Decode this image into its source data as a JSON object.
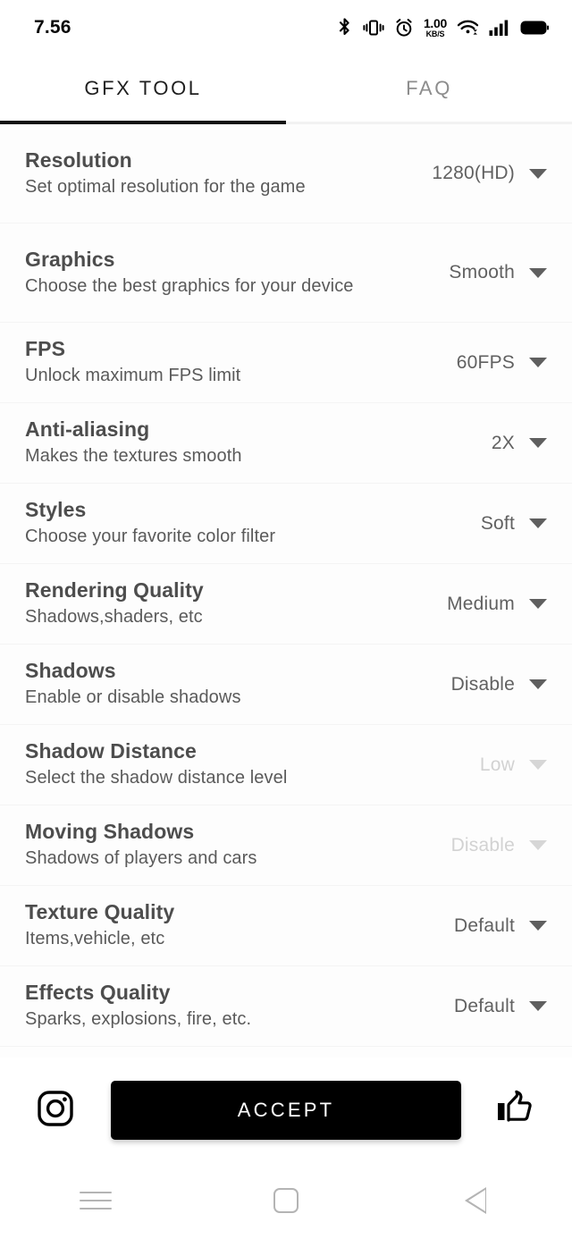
{
  "status_bar": {
    "time": "7.56",
    "data_rate_value": "1.00",
    "data_rate_unit": "KB/S",
    "icons": [
      "bluetooth-icon",
      "vibrate-icon",
      "alarm-icon",
      "data-rate-indicator",
      "wifi-icon",
      "cellular-signal-icon",
      "battery-icon"
    ]
  },
  "tabs": [
    {
      "label": "GFX TOOL",
      "active": true
    },
    {
      "label": "FAQ",
      "active": false
    }
  ],
  "settings": [
    {
      "title": "Resolution",
      "subtitle": "Set optimal resolution for the game",
      "value": "1280(HD)",
      "disabled": false
    },
    {
      "title": "Graphics",
      "subtitle": "Choose the best graphics for your device",
      "value": "Smooth",
      "disabled": false
    },
    {
      "title": "FPS",
      "subtitle": "Unlock maximum FPS limit",
      "value": "60FPS",
      "disabled": false
    },
    {
      "title": "Anti-aliasing",
      "subtitle": "Makes the textures smooth",
      "value": "2X",
      "disabled": false
    },
    {
      "title": "Styles",
      "subtitle": "Choose your favorite color filter",
      "value": "Soft",
      "disabled": false
    },
    {
      "title": "Rendering Quality",
      "subtitle": "Shadows,shaders, etc",
      "value": "Medium",
      "disabled": false
    },
    {
      "title": "Shadows",
      "subtitle": "Enable or disable shadows",
      "value": "Disable",
      "disabled": false
    },
    {
      "title": "Shadow Distance",
      "subtitle": "Select the shadow distance level",
      "value": "Low",
      "disabled": true
    },
    {
      "title": "Moving Shadows",
      "subtitle": "Shadows of players and cars",
      "value": "Disable",
      "disabled": true
    },
    {
      "title": "Texture Quality",
      "subtitle": "Items,vehicle, etc",
      "value": "Default",
      "disabled": false
    },
    {
      "title": "Effects Quality",
      "subtitle": "Sparks, explosions, fire, etc.",
      "value": "Default",
      "disabled": false
    }
  ],
  "bottom_bar": {
    "instagram_icon": "instagram-icon",
    "accept_label": "ACCEPT",
    "thumbs_up_icon": "thumbs-up-icon"
  },
  "nav_bar": {
    "recents_icon": "hamburger-recents-icon",
    "home_icon": "home-square-icon",
    "back_icon": "back-triangle-icon"
  },
  "colors": {
    "accent": "#000000",
    "title_text": "#4d4d4d",
    "subtitle_text": "#5a5a5a",
    "value_text": "#616161",
    "disabled_text": "#d2d2d2",
    "background": "#fdfdfd"
  }
}
